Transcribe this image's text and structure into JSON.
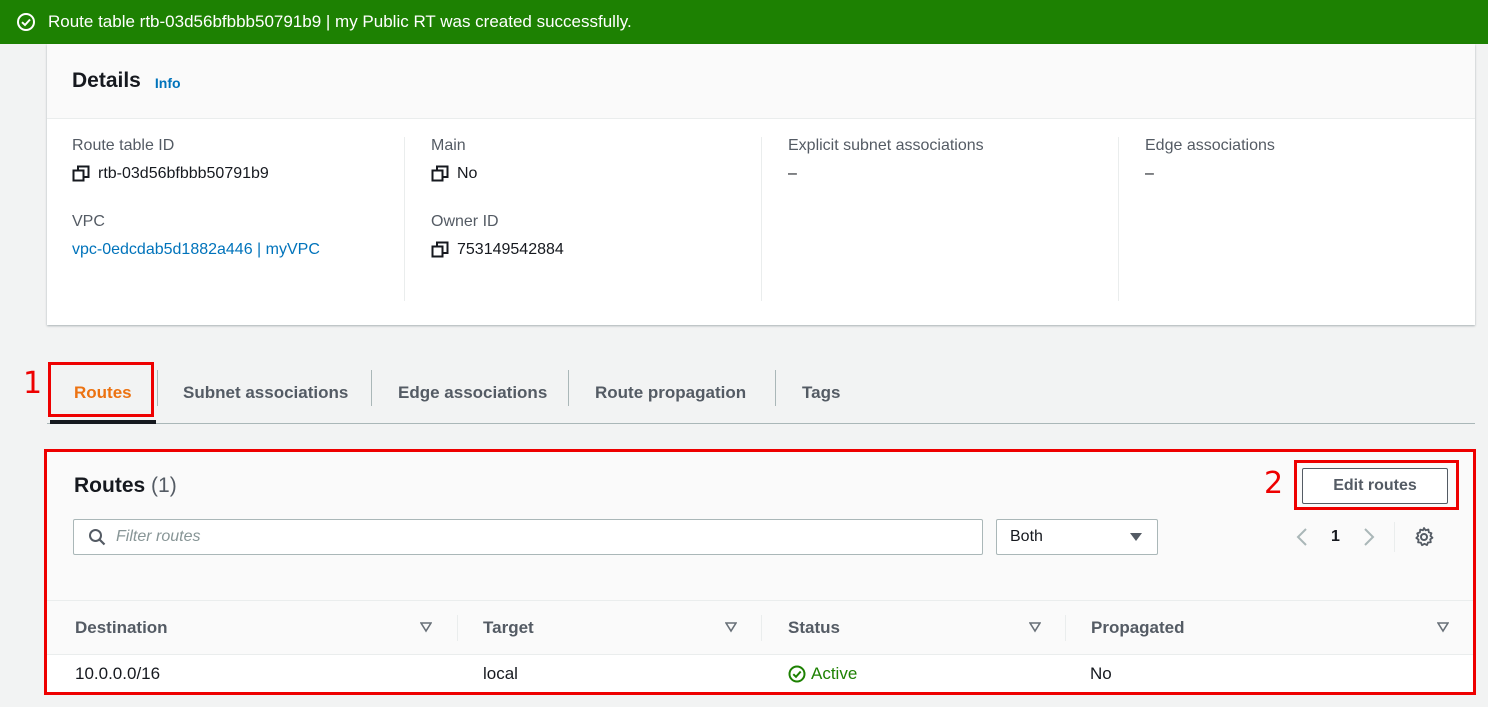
{
  "flash": {
    "message": "Route table rtb-03d56bfbbb50791b9 | my Public RT was created successfully.",
    "icon": "success-check-icon",
    "color": "#1d8102"
  },
  "details": {
    "title": "Details",
    "info": "Info",
    "route_table_id": {
      "label": "Route table ID",
      "value": "rtb-03d56bfbbb50791b9"
    },
    "vpc": {
      "label": "VPC",
      "value": "vpc-0edcdab5d1882a446 | myVPC"
    },
    "main": {
      "label": "Main",
      "value": "No"
    },
    "owner_id": {
      "label": "Owner ID",
      "value": "753149542884"
    },
    "explicit_subnet": {
      "label": "Explicit subnet associations",
      "value": "–"
    },
    "edge": {
      "label": "Edge associations",
      "value": "–"
    }
  },
  "tabs": [
    {
      "label": "Routes",
      "active": true
    },
    {
      "label": "Subnet associations"
    },
    {
      "label": "Edge associations"
    },
    {
      "label": "Route propagation"
    },
    {
      "label": "Tags"
    }
  ],
  "annotations": {
    "one": "1",
    "two": "2",
    "color": "#e00000"
  },
  "routes": {
    "title": "Routes",
    "count": "(1)",
    "edit_button": "Edit routes",
    "filter_placeholder": "Filter routes",
    "select_value": "Both",
    "page": "1",
    "columns": [
      "Destination",
      "Target",
      "Status",
      "Propagated"
    ],
    "rows": [
      {
        "destination": "10.0.0.0/16",
        "target": "local",
        "status": "Active",
        "propagated": "No"
      }
    ]
  }
}
